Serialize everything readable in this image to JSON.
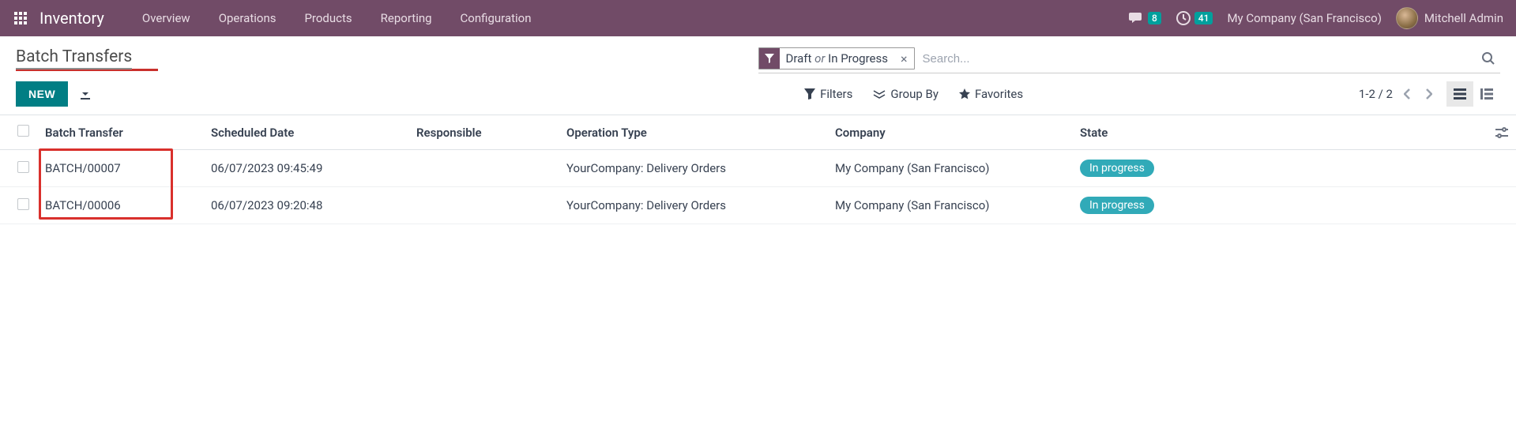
{
  "navbar": {
    "brand": "Inventory",
    "menu": [
      "Overview",
      "Operations",
      "Products",
      "Reporting",
      "Configuration"
    ],
    "messages_badge": "8",
    "activities_badge": "41",
    "company": "My Company (San Francisco)",
    "user_name": "Mitchell Admin"
  },
  "header": {
    "breadcrumb": "Batch Transfers"
  },
  "search": {
    "chip_prefix": "Draft",
    "chip_sep": "or",
    "chip_suffix": "In Progress",
    "placeholder": "Search..."
  },
  "toolbar": {
    "new_label": "NEW",
    "filters": "Filters",
    "groupby": "Group By",
    "favorites": "Favorites",
    "pager": "1-2 / 2"
  },
  "table": {
    "columns": {
      "batch": "Batch Transfer",
      "date": "Scheduled Date",
      "responsible": "Responsible",
      "optype": "Operation Type",
      "company": "Company",
      "state": "State"
    },
    "rows": [
      {
        "batch": "BATCH/00007",
        "date": "06/07/2023 09:45:49",
        "responsible": "",
        "optype": "YourCompany: Delivery Orders",
        "company": "My Company (San Francisco)",
        "state": "In progress"
      },
      {
        "batch": "BATCH/00006",
        "date": "06/07/2023 09:20:48",
        "responsible": "",
        "optype": "YourCompany: Delivery Orders",
        "company": "My Company (San Francisco)",
        "state": "In progress"
      }
    ]
  }
}
